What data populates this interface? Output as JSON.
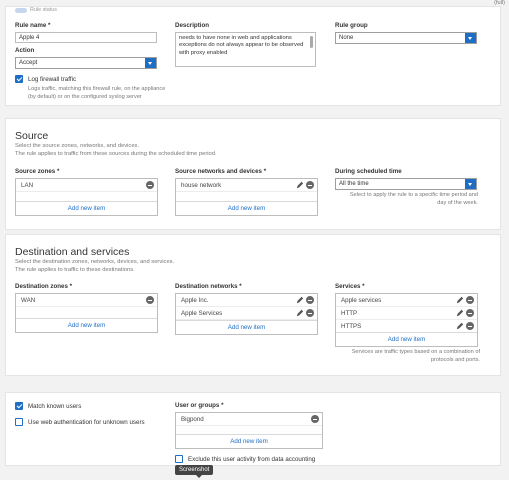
{
  "top_strip": {
    "corner_text": "(full)",
    "rule_status_label": "Rule status"
  },
  "rule": {
    "name_label": "Rule name *",
    "name_value": "Apple 4",
    "description_label": "Description",
    "description_value": "needs to have none in web and applications exceptions do not always appear to be observed with proxy enabled",
    "group_label": "Rule group",
    "group_value": "None",
    "action_label": "Action",
    "action_value": "Accept",
    "log_label": "Log firewall traffic",
    "log_checked": true,
    "log_help": "Logs traffic, matching this firewall rule, on the appliance (by default) or on the configured syslog server"
  },
  "source": {
    "title": "Source",
    "subtitle_1": "Select the source zones, networks, and devices.",
    "subtitle_2": "The rule applies to traffic from these sources during the scheduled time period.",
    "zones_label": "Source zones *",
    "zones": [
      "LAN"
    ],
    "zones_add": "Add new item",
    "networks_label": "Source networks and devices *",
    "networks": [
      "house network"
    ],
    "networks_add": "Add new item",
    "schedule_label": "During scheduled time",
    "schedule_value": "All the time",
    "schedule_help": "Select to apply the rule to a specific time period and day of the week."
  },
  "destination": {
    "title": "Destination and services",
    "subtitle_1": "Select the destination zones, networks, devices, and services.",
    "subtitle_2": "The rule applies to traffic to these destinations.",
    "zones_label": "Destination zones *",
    "zones": [
      "WAN"
    ],
    "zones_add": "Add new item",
    "networks_label": "Destination networks *",
    "networks": [
      "Apple Inc.",
      "Apple Services"
    ],
    "networks_add": "Add new item",
    "services_label": "Services *",
    "services": [
      "Apple services",
      "HTTP",
      "HTTPS"
    ],
    "services_add": "Add new item",
    "services_help": "Services are traffic types based on a combination of protocols and ports."
  },
  "users": {
    "match_label": "Match known users",
    "match_checked": true,
    "webauth_label": "Use web authentication for unknown users",
    "webauth_checked": false,
    "groups_label": "User or groups *",
    "groups": [
      "Bigpond"
    ],
    "groups_add": "Add new item",
    "exclude_label": "Exclude this user activity from data accounting",
    "exclude_checked": false
  },
  "tooltip": "Screenshot",
  "colors": {
    "accent": "#1f6ec5",
    "panel": "#ffffff",
    "background": "#f2f2f2"
  },
  "icons": {
    "dropdown": "chevron-down-icon",
    "remove": "minus-circle-icon",
    "edit": "pencil-icon",
    "check": "checkmark-icon"
  }
}
